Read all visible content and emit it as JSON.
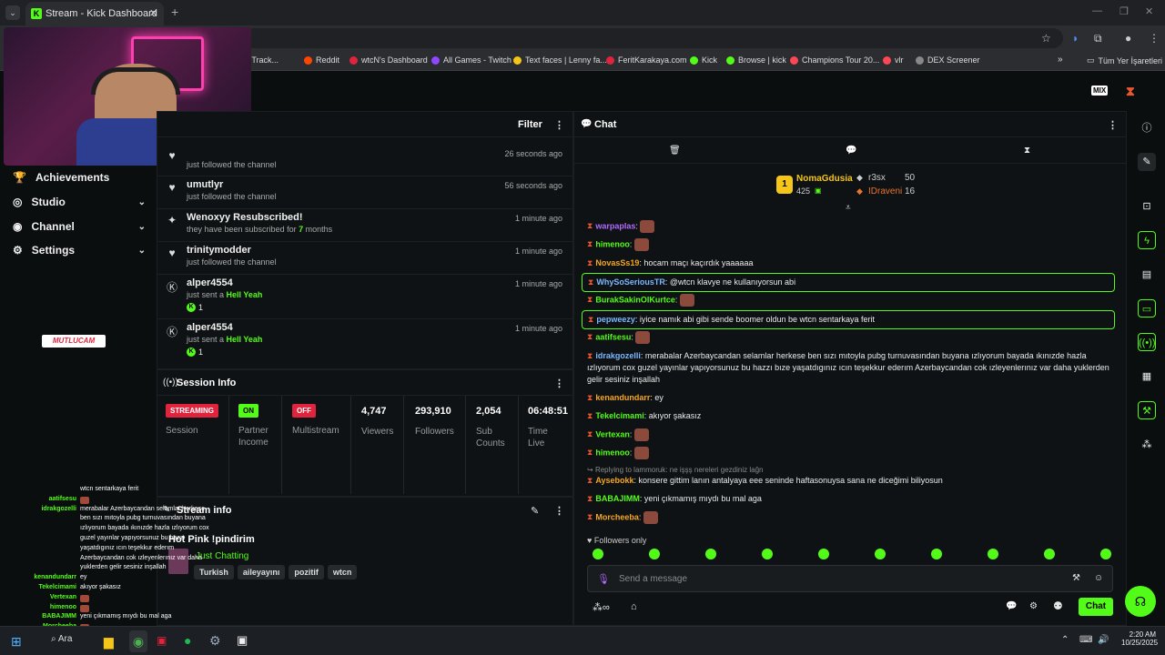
{
  "browser": {
    "tab_title": "Stream - Kick Dashboard",
    "bookmarks": [
      {
        "label": "iew – Track...",
        "color": "#e8742d"
      },
      {
        "label": "Reddit",
        "color": "#ff4500"
      },
      {
        "label": "wtcN's Dashboard",
        "color": "#e0243e"
      },
      {
        "label": "All Games - Twitch",
        "color": "#9146ff"
      },
      {
        "label": "Text faces | Lenny fa...",
        "color": "#f5c518"
      },
      {
        "label": "FeritKarakaya.com",
        "color": "#e0243e"
      },
      {
        "label": "Kick",
        "color": "#53fc18"
      },
      {
        "label": "Browse | kick",
        "color": "#53fc18"
      },
      {
        "label": "Champions Tour 20...",
        "color": "#ff4655"
      },
      {
        "label": "vlr",
        "color": "#ff4655"
      },
      {
        "label": "DEX Screener",
        "color": "#888888"
      }
    ],
    "other_bookmarks": "Tüm Yer İşaretleri"
  },
  "sidebar": {
    "items": [
      {
        "label": "Achievements",
        "icon": "trophy-icon"
      },
      {
        "label": "Studio",
        "icon": "studio-icon"
      },
      {
        "label": "Channel",
        "icon": "channel-icon"
      },
      {
        "label": "Settings",
        "icon": "gear-icon"
      }
    ],
    "overlay_logo": "MUTLUCAM"
  },
  "activity": {
    "filter_label": "Filter",
    "items": [
      {
        "name": "",
        "sub": "just followed the channel",
        "time": "26 seconds ago",
        "icon": "heart-icon"
      },
      {
        "name": "umutlyr",
        "sub": "just followed the channel",
        "time": "56 seconds ago",
        "icon": "heart-icon"
      },
      {
        "name": "Wenoxyy Resubscribed!",
        "sub_pre": "they have been subscribed for ",
        "sub_strong": "7",
        "sub_post": " months",
        "time": "1 minute ago",
        "icon": "sparkle-icon"
      },
      {
        "name": "trinitymodder",
        "sub": "just followed the channel",
        "time": "1 minute ago",
        "icon": "heart-icon"
      },
      {
        "name": "alper4554",
        "sub_pre": "just sent a ",
        "sub_strong": "Hell Yeah",
        "count": "1",
        "time": "1 minute ago",
        "icon": "kick-icon"
      },
      {
        "name": "alper4554",
        "sub_pre": "just sent a ",
        "sub_strong": "Hell Yeah",
        "count": "1",
        "time": "1 minute ago",
        "icon": "kick-icon"
      }
    ]
  },
  "session": {
    "title": "Session Info",
    "streaming": "STREAMING",
    "session_label": "Session",
    "on": "ON",
    "partner_label": "Partner Income",
    "off": "OFF",
    "multistream_label": "Multistream",
    "viewers": "4,747",
    "viewers_label": "Viewers",
    "followers": "293,910",
    "followers_label": "Followers",
    "subs": "2,054",
    "subs_label": "Sub Counts",
    "time": "06:48:51",
    "time_label": "Time Live"
  },
  "stream_info": {
    "title": "Stream info",
    "stream_title": "Hot Pink !pindirim",
    "category": "Just Chatting",
    "tags": [
      "Turkish",
      "aileyayını",
      "pozitif",
      "wtcn"
    ]
  },
  "overlay_chat": [
    {
      "name": "",
      "msg": "wtcn sentarkaya ferit"
    },
    {
      "name": "aatifsesu",
      "msg": ""
    },
    {
      "name": "idrakgozelli",
      "msg": "merabalar Azerbaycandan selamlar herkese"
    },
    {
      "name": "",
      "msg": "ben sızı mıtoyla pubg turnuvasından buyana"
    },
    {
      "name": "",
      "msg": "ızlıyorum bayada ıkınızde hazla ızlıyorum cox"
    },
    {
      "name": "",
      "msg": "guzel yayınlar yapıyorsunuz bu hazzı"
    },
    {
      "name": "",
      "msg": "yaşatdıgınız ıcın teşekkur ederım"
    },
    {
      "name": "",
      "msg": "Azerbaycandan cok ızleyenlerınız var daha"
    },
    {
      "name": "",
      "msg": "yuklerden gelir sesiniz inşallah"
    },
    {
      "name": "kenandundarr",
      "msg": "ey"
    },
    {
      "name": "Tekelcimami",
      "msg": "akıyor şakasız"
    },
    {
      "name": "Vertexan",
      "msg": ""
    },
    {
      "name": "himenoo",
      "msg": ""
    },
    {
      "name": "BABAJIMM",
      "msg": "yeni çıkmamış mıydı bu mal aga"
    },
    {
      "name": "Morcheeba",
      "msg": ""
    }
  ],
  "chat": {
    "title": "Chat",
    "leaderboard": {
      "rank": "1",
      "top_name": "NomaGdusia",
      "top_value": "425",
      "second_name": "r3sx",
      "second_value": "50",
      "third_name": "IDraveni",
      "third_value": "16"
    },
    "messages": [
      {
        "user": "warpaplas",
        "color": "#b36bff",
        "text": "",
        "emote": true
      },
      {
        "user": "himenoo",
        "color": "#53fc18",
        "text": "",
        "emote": true
      },
      {
        "user": "NovasSs19",
        "color": "#f5a623",
        "text": "hocam maçı kaçırdık yaaaaaa"
      },
      {
        "user": "WhySoSeriousTR",
        "color": "#7ab8ff",
        "text": "@wtcn klavye ne kullanıyorsun abi",
        "highlight": true
      },
      {
        "user": "BurakSakinOlKurtce",
        "color": "#53fc18",
        "text": "",
        "emote": true
      },
      {
        "user": "pepweezy",
        "color": "#7ab8ff",
        "text": "iyice namık abi gibi sende boomer oldun be wtcn sentarkaya ferit",
        "highlight": true
      },
      {
        "user": "aatifsesu",
        "color": "#53fc18",
        "text": "",
        "emote": true
      },
      {
        "user": "idrakgozelli",
        "color": "#7ab8ff",
        "text": "merabalar Azerbaycandan selamlar herkese ben sızı mıtoyla pubg turnuvasından buyana ızlıyorum bayada ıkınızde hazla ızlıyorum cox guzel yayınlar yapıyorsunuz bu hazzı bıze yaşatdıgınız ıcın teşekkur ederım Azerbaycandan cok ızleyenlerınız var daha yuklerden gelir sesiniz inşallah"
      },
      {
        "user": "kenandundarr",
        "color": "#f5a623",
        "text": "ey"
      },
      {
        "user": "Tekelcimami",
        "color": "#53fc18",
        "text": "akıyor şakasız"
      },
      {
        "user": "Vertexan",
        "color": "#53fc18",
        "text": "",
        "emote": true
      },
      {
        "user": "himenoo",
        "color": "#53fc18",
        "text": "",
        "emote": true
      },
      {
        "reply": "Replying to lammoruk: ne işşş nereleri gezdiniz lağn"
      },
      {
        "user": "Aysebokk",
        "color": "#f5a623",
        "text": "konsere gittim lanın antalyaya eee seninde haftasonuysa sana ne diceğimi biliyosun"
      },
      {
        "user": "BABAJIMM",
        "color": "#53fc18",
        "text": "yeni çıkmamış mıydı bu mal aga"
      },
      {
        "user": "Morcheeba",
        "color": "#f5a623",
        "text": "",
        "emote": true
      }
    ],
    "followers_only": "Followers only",
    "input_placeholder": "Send a message",
    "send_label": "Chat"
  },
  "taskbar": {
    "search": "Ara",
    "time": "2:20 AM",
    "date": "10/25/2025"
  }
}
